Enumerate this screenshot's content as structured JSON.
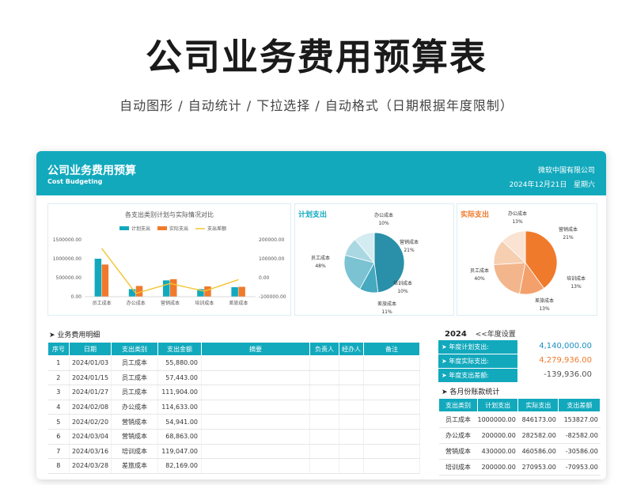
{
  "header": {
    "title": "公司业务费用预算表",
    "subtitle": "自动图形  /  自动统计  /  下拉选择    /  自动格式（日期根据年度限制）"
  },
  "sheet": {
    "title": "公司业务费用预算",
    "subtitle_en": "Cost Budgeting",
    "company": "微软中国有限公司",
    "date": "2024年12月21日",
    "weekday": "星期六"
  },
  "bar_chart_title": "各支出类别计划与实际情况对比",
  "plan_pie_title": "计划支出",
  "actual_pie_title": "实际支出",
  "chart_data": [
    {
      "type": "bar",
      "title": "各支出类别计划与实际情况对比",
      "categories": [
        "员工成本",
        "办公成本",
        "营销成本",
        "培训成本",
        "差旅成本"
      ],
      "series": [
        {
          "name": "计划支出",
          "values": [
            1000000,
            200000,
            430000,
            200000,
            250000
          ],
          "color": "#12a9bd"
        },
        {
          "name": "实际支出",
          "values": [
            846173,
            282582,
            460586,
            270953,
            260000
          ],
          "color": "#f07a2c"
        },
        {
          "name": "支出差额",
          "values": [
            153827,
            -82582,
            -30586,
            -70953,
            -10000
          ],
          "color": "#f4c430",
          "axis": "right",
          "kind": "line"
        }
      ],
      "y_ticks": [
        "1500000.00",
        "1000000.00",
        "500000.00",
        "0.00"
      ],
      "y2_ticks": [
        "200000.00",
        "100000.00",
        "0.00",
        "-100000.00"
      ],
      "ylim": [
        0,
        1500000
      ],
      "y2lim": [
        -100000,
        200000
      ],
      "legend": "top"
    },
    {
      "type": "pie",
      "title": "计划支出",
      "labels": [
        "员工成本",
        "办公成本",
        "营销成本",
        "培训成本",
        "差旅成本"
      ],
      "values": [
        48,
        10,
        21,
        10,
        11
      ],
      "pct_labels": [
        "48%",
        "10%",
        "21%",
        "10%",
        "11%"
      ],
      "colors": [
        "#2a8fa8",
        "#45a9c0",
        "#7bc3d3",
        "#aad8e2",
        "#d3ecf1"
      ]
    },
    {
      "type": "pie",
      "title": "实际支出",
      "labels": [
        "员工成本",
        "办公成本",
        "营销成本",
        "培训成本",
        "差旅成本"
      ],
      "values": [
        40,
        13,
        21,
        13,
        13
      ],
      "pct_labels": [
        "40%",
        "13%",
        "21%",
        "13%",
        "13%"
      ],
      "colors": [
        "#f07a2c",
        "#f3a06c",
        "#f3b68c",
        "#f6cfb1",
        "#fae3d2"
      ]
    }
  ],
  "detail": {
    "section_title": "➤  业务费用明细",
    "headers": [
      "序号",
      "日期",
      "支出类别",
      "支出金额",
      "摘要",
      "负责人",
      "经办人",
      "备注"
    ],
    "rows": [
      [
        "1",
        "2024/01/03",
        "员工成本",
        "55,880.00"
      ],
      [
        "2",
        "2024/01/15",
        "员工成本",
        "57,443.00"
      ],
      [
        "3",
        "2024/01/27",
        "员工成本",
        "111,904.00"
      ],
      [
        "4",
        "2024/02/08",
        "办公成本",
        "114,633.00"
      ],
      [
        "5",
        "2024/02/20",
        "营销成本",
        "54,941.00"
      ],
      [
        "6",
        "2024/03/04",
        "营销成本",
        "68,863.00"
      ],
      [
        "7",
        "2024/03/16",
        "培训成本",
        "119,047.00"
      ],
      [
        "8",
        "2024/03/28",
        "差旅成本",
        "82,169.00"
      ]
    ]
  },
  "summary": {
    "year": "2024",
    "year_hint": "<<年度设置",
    "plan_label": "➤ 年度计划支出:",
    "plan_value": "4,140,000.00",
    "actual_label": "➤ 年度实际支出:",
    "actual_value": "4,279,936.00",
    "diff_label": "➤ 年度支出差额:",
    "diff_value": "-139,936.00",
    "monthly_title": "➤  各月份账款统计",
    "monthly_headers": [
      "支出类别",
      "计划支出",
      "实际支出",
      "支出差额"
    ],
    "monthly_rows": [
      [
        "员工成本",
        "1000000.00",
        "846173.00",
        "153827.00"
      ],
      [
        "办公成本",
        "200000.00",
        "282582.00",
        "-82582.00"
      ],
      [
        "营销成本",
        "430000.00",
        "460586.00",
        "-30586.00"
      ],
      [
        "培训成本",
        "200000.00",
        "270953.00",
        "-70953.00"
      ]
    ]
  },
  "colors": {
    "accent": "#12a9bd",
    "orange": "#f07a2c",
    "line": "#f4c430",
    "plan_value": "#1a8fc2",
    "actual_value": "#f07a2c",
    "diff_value": "#555555"
  }
}
